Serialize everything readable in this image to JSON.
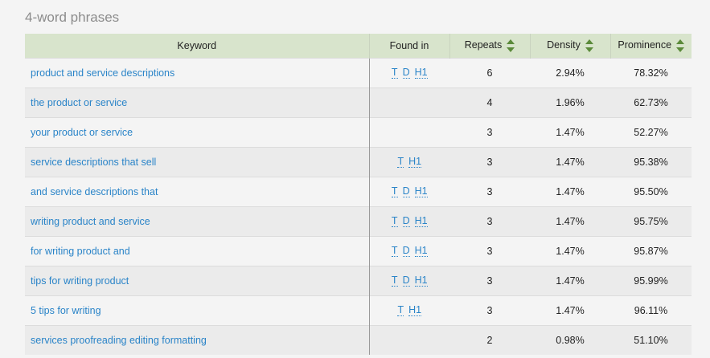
{
  "section_title": "4-word phrases",
  "columns": {
    "keyword": "Keyword",
    "found_in": "Found in",
    "repeats": "Repeats",
    "density": "Density",
    "prominence": "Prominence"
  },
  "rows": [
    {
      "keyword": "product and service descriptions",
      "found_in": [
        "T",
        "D",
        "H1"
      ],
      "repeats": "6",
      "density": "2.94%",
      "prominence": "78.32%"
    },
    {
      "keyword": "the product or service",
      "found_in": [],
      "repeats": "4",
      "density": "1.96%",
      "prominence": "62.73%"
    },
    {
      "keyword": "your product or service",
      "found_in": [],
      "repeats": "3",
      "density": "1.47%",
      "prominence": "52.27%"
    },
    {
      "keyword": "service descriptions that sell",
      "found_in": [
        "T",
        "H1"
      ],
      "repeats": "3",
      "density": "1.47%",
      "prominence": "95.38%"
    },
    {
      "keyword": "and service descriptions that",
      "found_in": [
        "T",
        "D",
        "H1"
      ],
      "repeats": "3",
      "density": "1.47%",
      "prominence": "95.50%"
    },
    {
      "keyword": "writing product and service",
      "found_in": [
        "T",
        "D",
        "H1"
      ],
      "repeats": "3",
      "density": "1.47%",
      "prominence": "95.75%"
    },
    {
      "keyword": "for writing product and",
      "found_in": [
        "T",
        "D",
        "H1"
      ],
      "repeats": "3",
      "density": "1.47%",
      "prominence": "95.87%"
    },
    {
      "keyword": "tips for writing product",
      "found_in": [
        "T",
        "D",
        "H1"
      ],
      "repeats": "3",
      "density": "1.47%",
      "prominence": "95.99%"
    },
    {
      "keyword": "5 tips for writing",
      "found_in": [
        "T",
        "H1"
      ],
      "repeats": "3",
      "density": "1.47%",
      "prominence": "96.11%"
    },
    {
      "keyword": "services proofreading editing formatting",
      "found_in": [],
      "repeats": "2",
      "density": "0.98%",
      "prominence": "51.10%"
    }
  ],
  "icons": {
    "sort": "sort-up-down-icon"
  },
  "colors": {
    "header_bg": "#d8e4cc",
    "link": "#2a84c8",
    "sort_arrow": "#5b8a3a",
    "title": "#8c8c8c"
  }
}
